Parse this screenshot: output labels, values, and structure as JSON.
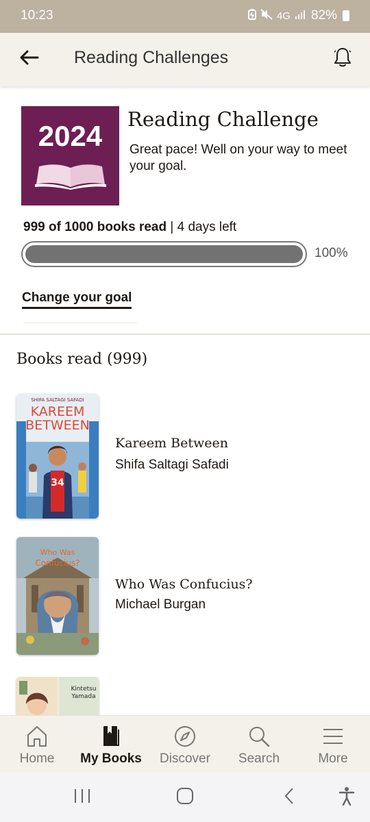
{
  "status_bar": {
    "time": "10:23",
    "network": "4G",
    "battery": "82%"
  },
  "app_bar": {
    "title": "Reading Challenges"
  },
  "challenge": {
    "year": "2024",
    "title": "Reading Challenge",
    "subtitle": "Great pace! Well on your way to meet your goal.",
    "books_read_text": "999 of 1000 books read",
    "days_left_text": " | 4 days left",
    "progress_percent": 100,
    "progress_label": "100%",
    "change_goal_label": "Change your goal",
    "badge_color": "#6d1f54"
  },
  "books_section": {
    "heading": "Books read (999)",
    "books": [
      {
        "title": "Kareem Between",
        "author": "Shifa Saltagi Safadi",
        "cover_author": "SHIFA SALTAGI SAFADI",
        "cover_title_1": "KAREEM",
        "cover_title_2": "BETWEEN",
        "cover_number": "34"
      },
      {
        "title": "Who Was Confucius?",
        "author": "Michael Burgan",
        "cover_title_1": "Who Was",
        "cover_title_2": "Confucius?"
      },
      {
        "title": "",
        "author": "",
        "cover_title_1": "Kintetsu",
        "cover_title_2": "Yamada"
      }
    ]
  },
  "bottom_nav": {
    "items": [
      {
        "label": "Home",
        "icon": "home-icon"
      },
      {
        "label": "My Books",
        "icon": "book-icon"
      },
      {
        "label": "Discover",
        "icon": "compass-icon"
      },
      {
        "label": "Search",
        "icon": "search-icon"
      },
      {
        "label": "More",
        "icon": "menu-icon"
      }
    ],
    "active": "My Books"
  },
  "system_nav": {
    "buttons": [
      "recents",
      "home",
      "back",
      "accessibility"
    ]
  }
}
